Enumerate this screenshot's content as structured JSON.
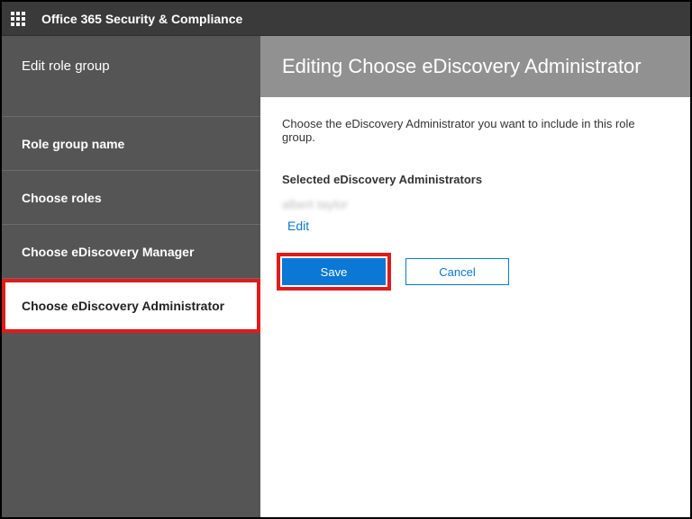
{
  "topbar": {
    "title": "Office 365 Security & Compliance"
  },
  "sidebar": {
    "header": "Edit role group",
    "steps": [
      {
        "label": "Role group name"
      },
      {
        "label": "Choose roles"
      },
      {
        "label": "Choose eDiscovery Manager"
      },
      {
        "label": "Choose eDiscovery Administrator"
      }
    ]
  },
  "main": {
    "title": "Editing Choose eDiscovery Administrator",
    "instruction": "Choose the eDiscovery Administrator you want to include in this role group.",
    "selected_heading": "Selected eDiscovery Administrators",
    "selected_user": "albert taylor",
    "edit_label": "Edit",
    "save_label": "Save",
    "cancel_label": "Cancel"
  }
}
